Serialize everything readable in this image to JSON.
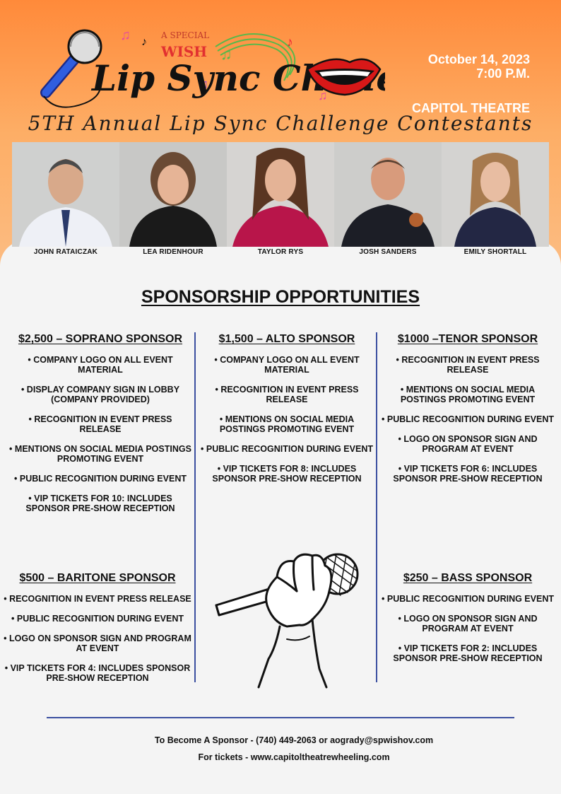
{
  "header": {
    "logo_top": "A SPECIAL",
    "logo_wish": "WISH",
    "logo_title": "Lip Sync Challenge",
    "date": "October 14, 2023",
    "time": "7:00 P.M.",
    "venue": "CAPITOL THEATRE",
    "contestants_title": "5TH Annual Lip Sync Challenge Contestants"
  },
  "contestants": [
    {
      "name": "JOHN RATAICZAK"
    },
    {
      "name": "LEA RIDENHOUR"
    },
    {
      "name": "TAYLOR RYS"
    },
    {
      "name": "JOSH SANDERS"
    },
    {
      "name": "EMILY SHORTALL"
    }
  ],
  "sponsorship": {
    "heading": "SPONSORSHIP OPPORTUNITIES",
    "tiers": [
      {
        "title": "$2,500 – SOPRANO SPONSOR",
        "items": [
          "COMPANY LOGO ON ALL EVENT MATERIAL",
          "DISPLAY COMPANY SIGN IN LOBBY (COMPANY PROVIDED)",
          "RECOGNITION IN EVENT PRESS RELEASE",
          "MENTIONS ON SOCIAL MEDIA POSTINGS PROMOTING EVENT",
          "PUBLIC RECOGNITION DURING EVENT",
          "VIP TICKETS FOR 10: INCLUDES SPONSOR PRE-SHOW RECEPTION"
        ]
      },
      {
        "title": "$1,500 – ALTO SPONSOR",
        "items": [
          "COMPANY LOGO ON ALL EVENT MATERIAL",
          "RECOGNITION IN EVENT PRESS RELEASE",
          "MENTIONS ON SOCIAL MEDIA POSTINGS PROMOTING EVENT",
          "PUBLIC RECOGNITION DURING EVENT",
          "VIP TICKETS FOR 8: INCLUDES SPONSOR PRE-SHOW RECEPTION"
        ]
      },
      {
        "title": "$1000 –TENOR SPONSOR",
        "items": [
          "RECOGNITION IN EVENT PRESS RELEASE",
          "MENTIONS ON SOCIAL MEDIA POSTINGS PROMOTING EVENT",
          "PUBLIC RECOGNITION DURING EVENT",
          "LOGO ON SPONSOR SIGN AND PROGRAM AT EVENT",
          "VIP TICKETS FOR 6: INCLUDES SPONSOR PRE-SHOW RECEPTION"
        ]
      },
      {
        "title": "$500 – BARITONE SPONSOR",
        "items": [
          "RECOGNITION IN EVENT PRESS RELEASE",
          "PUBLIC RECOGNITION DURING EVENT",
          "LOGO ON SPONSOR SIGN AND PROGRAM AT EVENT",
          "VIP TICKETS FOR 4: INCLUDES SPONSOR PRE-SHOW RECEPTION"
        ]
      },
      {
        "title": "$250 – BASS SPONSOR",
        "items": [
          "PUBLIC RECOGNITION DURING EVENT",
          "LOGO ON SPONSOR SIGN AND PROGRAM AT EVENT",
          "VIP TICKETS FOR 2: INCLUDES SPONSOR PRE-SHOW RECEPTION"
        ]
      }
    ]
  },
  "contact": {
    "sponsor_line": "To Become A Sponsor - (740) 449-2063  or aogrady@spwishov.com",
    "tickets_line": "For tickets - www.capitoltheatrewheeling.com"
  }
}
